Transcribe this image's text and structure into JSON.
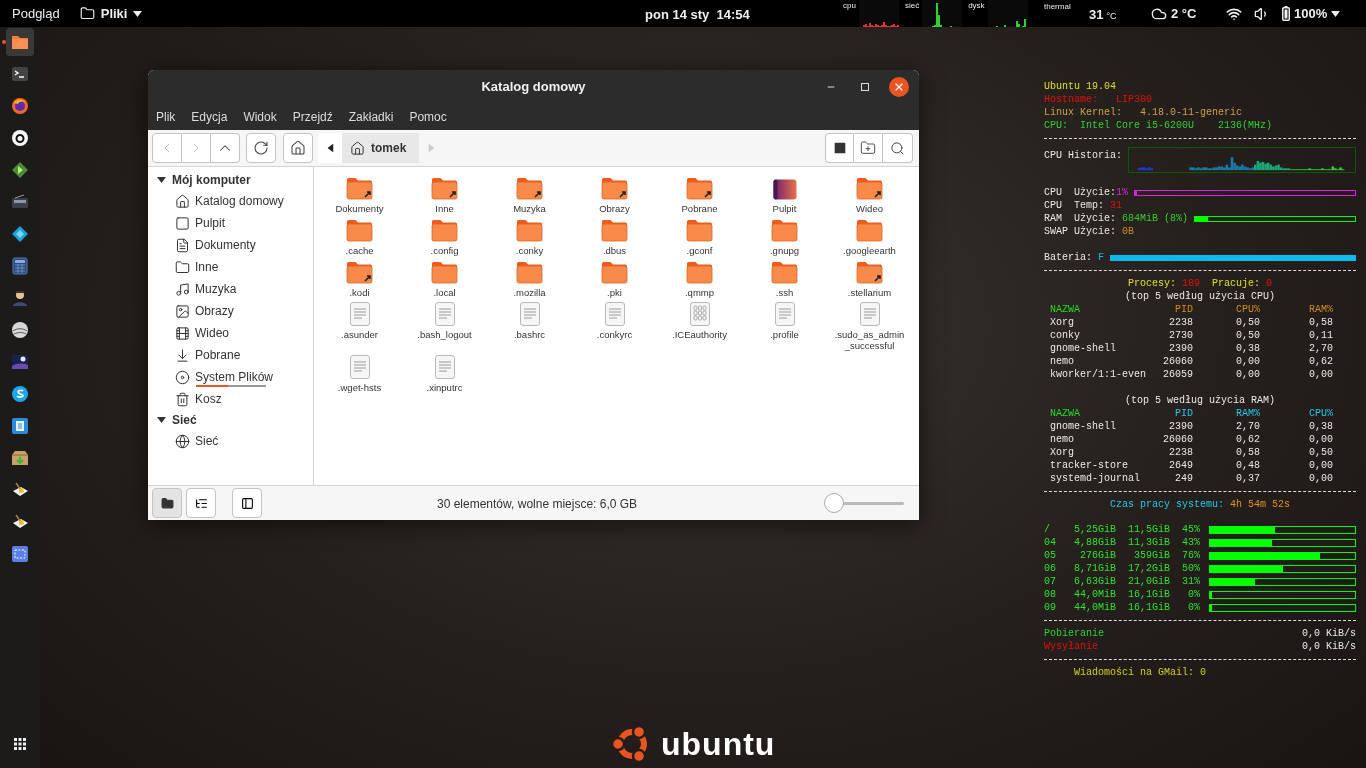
{
  "top_bar": {
    "activities": "Podgląd",
    "app_menu": "Pliki",
    "date": "pon 14 sty",
    "time": "14:54",
    "monitors": [
      {
        "label": "cpu",
        "kind": "cpu"
      },
      {
        "label": "sieć",
        "kind": "net"
      },
      {
        "label": "dysk",
        "kind": "disk"
      }
    ],
    "thermal": {
      "label": "thermal",
      "value": "31",
      "unit": "°C"
    },
    "weather": "2 °C",
    "battery": "100%"
  },
  "dock": {
    "apps": [
      {
        "kind": "files",
        "running": true
      },
      {
        "kind": "terminal",
        "running": false
      },
      {
        "kind": "browser",
        "running": false
      },
      {
        "kind": "circle-logo",
        "running": false
      },
      {
        "kind": "player",
        "running": false
      },
      {
        "kind": "radio",
        "running": false
      },
      {
        "kind": "diamond",
        "running": false
      },
      {
        "kind": "calculator",
        "running": false
      },
      {
        "kind": "person",
        "running": false
      },
      {
        "kind": "globe",
        "running": false
      },
      {
        "kind": "night-sky",
        "running": false
      },
      {
        "kind": "chat",
        "running": false
      },
      {
        "kind": "document",
        "running": false
      },
      {
        "kind": "package",
        "running": false
      },
      {
        "kind": "cleaner",
        "running": false
      },
      {
        "kind": "cleaner",
        "running": false
      },
      {
        "kind": "screenshot",
        "running": false
      }
    ]
  },
  "window": {
    "title": "Katalog domowy",
    "menu": [
      "Plik",
      "Edycja",
      "Widok",
      "Przejdź",
      "Zakładki",
      "Pomoc"
    ],
    "breadcrumb": "tomek",
    "sidebar": [
      {
        "title": "Mój komputer",
        "expanded": true,
        "items": [
          {
            "label": "Katalog domowy",
            "kind": "home"
          },
          {
            "label": "Pulpit",
            "kind": "desktop"
          },
          {
            "label": "Dokumenty",
            "kind": "documents"
          },
          {
            "label": "Inne",
            "kind": "folder"
          },
          {
            "label": "Muzyka",
            "kind": "music"
          },
          {
            "label": "Obrazy",
            "kind": "pictures"
          },
          {
            "label": "Wideo",
            "kind": "video"
          },
          {
            "label": "Pobrane",
            "kind": "downloads"
          },
          {
            "label": "System Plików",
            "kind": "filesystem",
            "level": 0.45
          },
          {
            "label": "Kosz",
            "kind": "trash"
          }
        ]
      },
      {
        "title": "Sieć",
        "expanded": true,
        "items": [
          {
            "label": "Sieć",
            "kind": "network"
          }
        ]
      }
    ],
    "files": [
      {
        "name": "Dokumenty",
        "kind": "folder-link"
      },
      {
        "name": "Inne",
        "kind": "folder-link"
      },
      {
        "name": "Muzyka",
        "kind": "folder-link"
      },
      {
        "name": "Obrazy",
        "kind": "folder-link"
      },
      {
        "name": "Pobrane",
        "kind": "folder-link"
      },
      {
        "name": "Pulpit",
        "kind": "desktop"
      },
      {
        "name": "Wideo",
        "kind": "folder-link"
      },
      {
        "name": ".cache",
        "kind": "folder"
      },
      {
        "name": ".config",
        "kind": "folder"
      },
      {
        "name": ".conky",
        "kind": "folder"
      },
      {
        "name": ".dbus",
        "kind": "folder"
      },
      {
        "name": ".gconf",
        "kind": "folder"
      },
      {
        "name": ".gnupg",
        "kind": "folder"
      },
      {
        "name": ".googleearth",
        "kind": "folder"
      },
      {
        "name": ".kodi",
        "kind": "folder-link"
      },
      {
        "name": ".local",
        "kind": "folder"
      },
      {
        "name": ".mozilla",
        "kind": "folder"
      },
      {
        "name": ".pki",
        "kind": "folder"
      },
      {
        "name": ".qmmp",
        "kind": "folder"
      },
      {
        "name": ".ssh",
        "kind": "folder"
      },
      {
        "name": ".stellarium",
        "kind": "folder-link"
      },
      {
        "name": ".asunder",
        "kind": "text"
      },
      {
        "name": ".bash_logout",
        "kind": "text"
      },
      {
        "name": ".bashrc",
        "kind": "text"
      },
      {
        "name": ".conkyrc",
        "kind": "text"
      },
      {
        "name": ".ICEauthority",
        "kind": "binary"
      },
      {
        "name": ".profile",
        "kind": "text"
      },
      {
        "name": ".sudo_as_admin_successful",
        "kind": "text"
      },
      {
        "name": ".wget-hsts",
        "kind": "text"
      },
      {
        "name": ".xinputrc",
        "kind": "text"
      }
    ],
    "status": "30 elementów, wolne miejsce: 6,0 GB",
    "zoom": {
      "level": 0.08
    },
    "view_buttons": [
      {
        "kind": "places",
        "selected": true
      },
      {
        "kind": "tree",
        "selected": false
      }
    ]
  },
  "conky": {
    "os": "Ubuntu 19.04",
    "hostname": {
      "label": "Hostname:",
      "value": "LIP300"
    },
    "kernel": {
      "label": "Linux Kernel:",
      "value": "4.18.0-11-generic"
    },
    "cpu_info": {
      "label": "CPU:",
      "model": "Intel Core i5-6200U",
      "freq": "2136(MHz)"
    },
    "cpu_history": "CPU Historia:",
    "cpu_usage": {
      "label": "CPU  Użycie:",
      "value": "1%",
      "level": 0.01
    },
    "cpu_temp": {
      "label": "CPU  Temp:",
      "value": "31"
    },
    "ram": {
      "label": "RAM  Użycie:",
      "value": "684MiB (8%)",
      "level": 0.08
    },
    "swap": {
      "label": "SWAP Użycie:",
      "value": "0B"
    },
    "battery": {
      "label": "Bateria:",
      "value": "F",
      "level": 1
    },
    "processes": {
      "label": "Procesy:",
      "value": "189",
      "running_label": "Pracuje:",
      "running": "0"
    },
    "tables": [
      {
        "title": "(top 5 według użycia CPU)",
        "columns": [
          {
            "label": "NAZWA",
            "color": "#22dd22"
          },
          {
            "label": "PID",
            "color": "#d08a1a"
          },
          {
            "label": "CPU%",
            "color": "#d08a1a"
          },
          {
            "label": "RAM%",
            "color": "#d08a1a"
          }
        ],
        "rows": [
          [
            "Xorg",
            "2238",
            "0,50",
            "0,58"
          ],
          [
            "conky",
            "2730",
            "0,50",
            "0,11"
          ],
          [
            "gnome-shell",
            "2390",
            "0,38",
            "2,70"
          ],
          [
            "nemo",
            "26060",
            "0,00",
            "0,62"
          ],
          [
            "kworker/1:1-even",
            "26059",
            "0,00",
            "0,00"
          ]
        ]
      },
      {
        "title": "(top 5 według użycia RAM)",
        "columns": [
          {
            "label": "NAZWA",
            "color": "#22dd22"
          },
          {
            "label": "PID",
            "color": "#22c8e6"
          },
          {
            "label": "RAM%",
            "color": "#22c8e6"
          },
          {
            "label": "CPU%",
            "color": "#22c8e6"
          }
        ],
        "rows": [
          [
            "gnome-shell",
            "2390",
            "2,70",
            "0,38"
          ],
          [
            "nemo",
            "26060",
            "0,62",
            "0,00"
          ],
          [
            "Xorg",
            "2238",
            "0,58",
            "0,50"
          ],
          [
            "tracker-store",
            "2649",
            "0,48",
            "0,00"
          ],
          [
            "systemd-journal",
            "249",
            "0,37",
            "0,00"
          ]
        ]
      }
    ],
    "uptime": {
      "label": "Czas pracy systemu:",
      "value": "4h 54m 52s"
    },
    "disks": [
      {
        "mount": "/",
        "used": "5,25GiB",
        "size": "11,5GiB",
        "percent": "45%",
        "level": 0.45
      },
      {
        "mount": "04",
        "used": "4,88GiB",
        "size": "11,3GiB",
        "percent": "43%",
        "level": 0.43
      },
      {
        "mount": "05",
        "used": "276GiB",
        "size": "359GiB",
        "percent": "76%",
        "level": 0.76
      },
      {
        "mount": "06",
        "used": "8,71GiB",
        "size": "17,2GiB",
        "percent": "50%",
        "level": 0.5
      },
      {
        "mount": "07",
        "used": "6,63GiB",
        "size": "21,0GiB",
        "percent": "31%",
        "level": 0.31
      },
      {
        "mount": "08",
        "used": "44,0MiB",
        "size": "16,1GiB",
        "percent": "0%",
        "level": 0
      },
      {
        "mount": "09",
        "used": "44,0MiB",
        "size": "16,1GiB",
        "percent": "0%",
        "level": 0
      }
    ],
    "network": [
      {
        "kind": "download",
        "label": "Pobieranie",
        "value": "0,0 KiB/s"
      },
      {
        "kind": "upload",
        "label": "Wysyłanie",
        "value": "0,0 KiB/s"
      }
    ],
    "gmail": "Wiadomości na GMail: 0"
  },
  "wallpaper": {
    "brand": "ubuntu"
  }
}
